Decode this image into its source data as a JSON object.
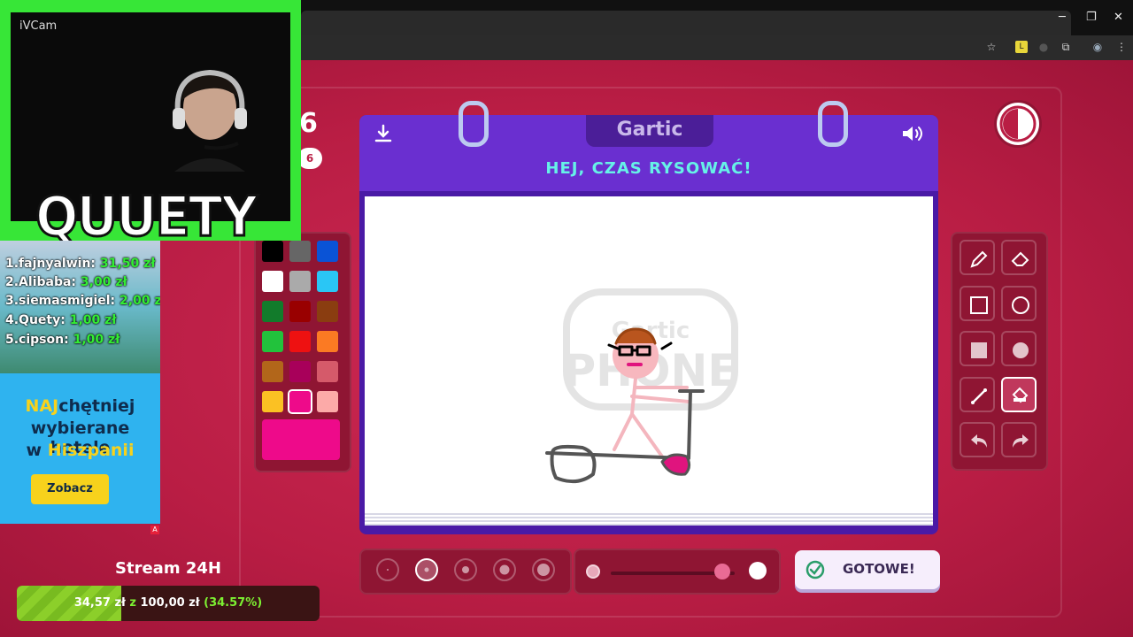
{
  "browser": {
    "window_controls": [
      "─",
      "❐",
      "✕"
    ]
  },
  "webcam": {
    "source_label": "iVCam",
    "streamer_name": "QUUETY"
  },
  "donors": [
    {
      "rank_name": "1.fajnyalwin:",
      "amount": "31,50 zł"
    },
    {
      "rank_name": "2.Alibaba:",
      "amount": "3,00 zł"
    },
    {
      "rank_name": "3.siemasmigiel:",
      "amount": "2,00 zł"
    },
    {
      "rank_name": "4.Quety:",
      "amount": "1,00 zł"
    },
    {
      "rank_name": "5.cipson:",
      "amount": "1,00 zł"
    }
  ],
  "ad": {
    "line1_highlight": "NAJ",
    "line1_rest": "chętniej",
    "line2": "wybierane hotele",
    "line3_prefix": "w ",
    "line3_highlight": "Hiszpanii",
    "button": "Zobacz",
    "badge": "A"
  },
  "stream_goal": {
    "title": "Stream 24H",
    "current": "34,57 zł",
    "separator": "z",
    "target": "100,00 zł",
    "percent_label": "(34.57%)",
    "progress": 0.3457
  },
  "round": {
    "number": "6",
    "pill": "6"
  },
  "notebook": {
    "logo": "Gartic",
    "instruction": "HEJ, CZAS RYSOWAĆ!",
    "watermark_line1": "Gartic",
    "watermark_line2": "PHONE"
  },
  "palette": {
    "colors": [
      "#000000",
      "#666666",
      "#0a53d6",
      "#ffffff",
      "#aaaaaa",
      "#2ac6f5",
      "#127b2b",
      "#990000",
      "#8a3d10",
      "#22c23c",
      "#ee1111",
      "#fb7a23",
      "#b2661a",
      "#a8005a",
      "#d55a6a",
      "#fbc123",
      "#ee0a8a",
      "#fcaaa8"
    ],
    "selected_index": 16,
    "current_color": "#ee0a8a"
  },
  "tools": {
    "items": [
      "pencil-icon",
      "eraser-icon",
      "rect-outline-icon",
      "ellipse-outline-icon",
      "rect-filled-icon",
      "ellipse-filled-icon",
      "line-icon",
      "bucket-icon",
      "undo-icon",
      "redo-icon"
    ],
    "selected_index": 7
  },
  "brush_sizes": {
    "count": 5,
    "selected_index": 1
  },
  "opacity": {
    "value": 0.9
  },
  "timer": {
    "remaining_fraction": 0.5
  },
  "done_button": {
    "label": "GOTOWE!"
  }
}
